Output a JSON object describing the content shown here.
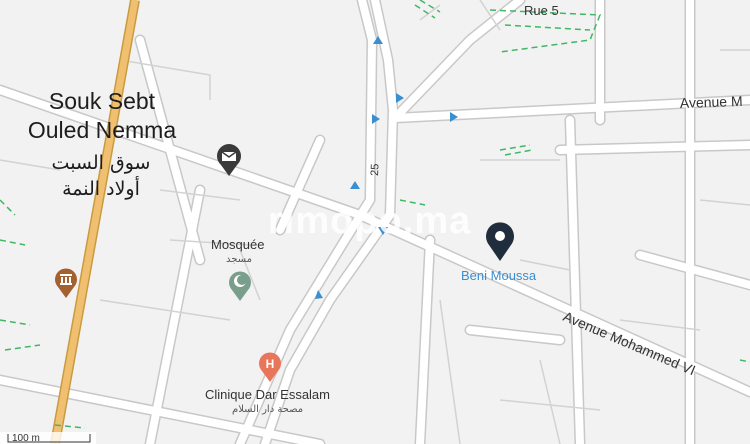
{
  "watermark": "rimopo.ma",
  "place": {
    "name_lines": [
      "Souk Sebt",
      "Ouled Nemma"
    ],
    "name_ar_lines": [
      "سوق السبت",
      "أولاد النمة"
    ]
  },
  "roads": {
    "rue5": "Rue 5",
    "avenue_m": "Avenue M",
    "avenue_mohammed_vi": "Avenue Mohammed VI",
    "route_number": "25"
  },
  "pois": {
    "mosque": {
      "name": "Mosquée",
      "name_ar": "مسجد",
      "icon": "mosque-pin-icon",
      "color": "#7a9e8c"
    },
    "clinic": {
      "name": "Clinique Dar Essalam",
      "name_ar": "مصحة دار السلام",
      "icon": "hospital-pin-icon",
      "color": "#e8765a"
    },
    "post": {
      "icon": "mail-pin-icon",
      "color": "#3a3a3a"
    },
    "museum": {
      "icon": "monument-pin-icon",
      "color": "#a5602f"
    },
    "selected": {
      "name": "Beni Moussa",
      "icon": "location-marker-icon",
      "color": "#1f2d3d"
    }
  },
  "scale": {
    "label": "100 m"
  },
  "colors": {
    "background": "#f2f2f2",
    "street": "#ffffff",
    "street_outline": "#c8c8c8",
    "highway": "#f0c070",
    "highway_outline": "#c99b3f",
    "green_dash": "#3fb864",
    "oneway_arrow": "#3a8fd0",
    "label_blue": "#3a8fd0"
  }
}
